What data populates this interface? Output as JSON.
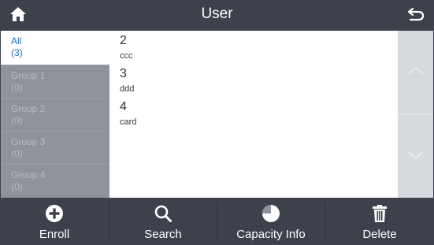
{
  "header": {
    "title": "User",
    "home_icon": "home-icon",
    "back_icon": "back-arrow-icon"
  },
  "groups": [
    {
      "label": "All",
      "count": "(3)",
      "active": true
    },
    {
      "label": "Group 1",
      "count": "(0)",
      "active": false
    },
    {
      "label": "Group 2",
      "count": "(0)",
      "active": false
    },
    {
      "label": "Group 3",
      "count": "(0)",
      "active": false
    },
    {
      "label": "Group 4",
      "count": "(0)",
      "active": false
    }
  ],
  "users": [
    {
      "id": "2",
      "name": "ccc"
    },
    {
      "id": "3",
      "name": "ddd"
    },
    {
      "id": "4",
      "name": "card"
    }
  ],
  "scroll": {
    "up_icon": "chevron-up-icon",
    "down_icon": "chevron-down-icon"
  },
  "toolbar": {
    "enroll_label": "Enroll",
    "search_label": "Search",
    "capacity_label": "Capacity Info",
    "delete_label": "Delete"
  },
  "colors": {
    "header_bg": "#3d414b",
    "sidebar_bg": "#8e939c",
    "active_text": "#1f6fb8",
    "scroll_bg": "#d6d9dd"
  }
}
